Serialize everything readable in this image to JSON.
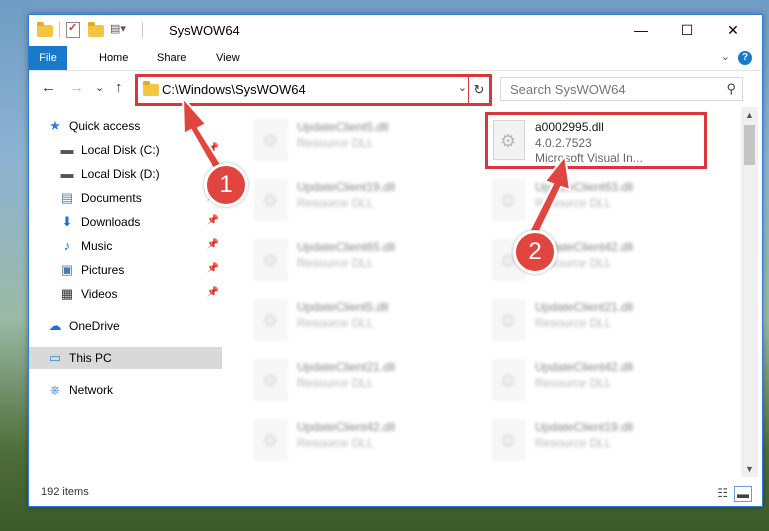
{
  "window": {
    "title": "SysWOW64",
    "controls": {
      "minimize": "—",
      "maximize": "☐",
      "close": "✕"
    }
  },
  "ribbon": {
    "tabs": [
      "File",
      "Home",
      "Share",
      "View"
    ],
    "help_label": "?",
    "collapse_label": "⌄"
  },
  "navigation": {
    "back": "←",
    "forward": "→",
    "recent": "⌄",
    "up": "↑",
    "address": "C:\\Windows\\SysWOW64",
    "address_dropdown": "⌄",
    "refresh": "↻",
    "search_placeholder": "Search SysWOW64",
    "search_icon": "⚲"
  },
  "sidebar": {
    "items": [
      {
        "label": "Quick access",
        "icon": "star-icon",
        "glyph": "★",
        "color": "#2b7fd6",
        "pinned": false
      },
      {
        "label": "Local Disk (C:)",
        "icon": "drive-icon",
        "glyph": "▬",
        "color": "#555555",
        "pinned": true
      },
      {
        "label": "Local Disk (D:)",
        "icon": "drive-icon",
        "glyph": "▬",
        "color": "#555555",
        "pinned": false
      },
      {
        "label": "Documents",
        "icon": "documents-icon",
        "glyph": "▤",
        "color": "#5a7fa8",
        "pinned": true
      },
      {
        "label": "Downloads",
        "icon": "downloads-icon",
        "glyph": "⬇",
        "color": "#1f6fcf",
        "pinned": true
      },
      {
        "label": "Music",
        "icon": "music-icon",
        "glyph": "♪",
        "color": "#1f6fcf",
        "pinned": true
      },
      {
        "label": "Pictures",
        "icon": "pictures-icon",
        "glyph": "▣",
        "color": "#4a7aa8",
        "pinned": true
      },
      {
        "label": "Videos",
        "icon": "videos-icon",
        "glyph": "▦",
        "color": "#333333",
        "pinned": true
      },
      {
        "label": "OneDrive",
        "icon": "onedrive-icon",
        "glyph": "☁",
        "color": "#1f6fcf",
        "pinned": false
      },
      {
        "label": "This PC",
        "icon": "pc-icon",
        "glyph": "▭",
        "color": "#3a8bd6",
        "pinned": false,
        "selected": true
      },
      {
        "label": "Network",
        "icon": "network-icon",
        "glyph": "⎈",
        "color": "#3a8bd6",
        "pinned": false
      }
    ],
    "pin_glyph": "📌"
  },
  "files": {
    "main": {
      "name": "a0002995.dll",
      "version": "4.0.2.7523",
      "company": "Microsoft Visual In..."
    },
    "blurred": [
      {
        "name": "UpdateClient5.dll",
        "desc": "Resource DLL"
      },
      {
        "name": "UpdateClient19.dll",
        "desc": "Resource DLL"
      },
      {
        "name": "UpdateClient63.dll",
        "desc": "Resource DLL"
      },
      {
        "name": "UpdateClient65.dll",
        "desc": "Resource DLL"
      },
      {
        "name": "UpdateClient42.dll",
        "desc": "Resource DLL"
      },
      {
        "name": "UpdateClient5.dll",
        "desc": "Resource DLL"
      },
      {
        "name": "UpdateClient21.dll",
        "desc": "Resource DLL"
      },
      {
        "name": "UpdateClient21.dll",
        "desc": "Resource DLL"
      },
      {
        "name": "UpdateClient42.dll",
        "desc": "Resource DLL"
      },
      {
        "name": "UpdateClient42.dll",
        "desc": "Resource DLL"
      },
      {
        "name": "UpdateClient19.dll",
        "desc": "Resource DLL"
      }
    ]
  },
  "status": {
    "item_count": "192 items",
    "details_view": "☷",
    "tiles_view": "▬"
  },
  "annotations": {
    "step1": "1",
    "step2": "2",
    "color": "#e0463f"
  }
}
